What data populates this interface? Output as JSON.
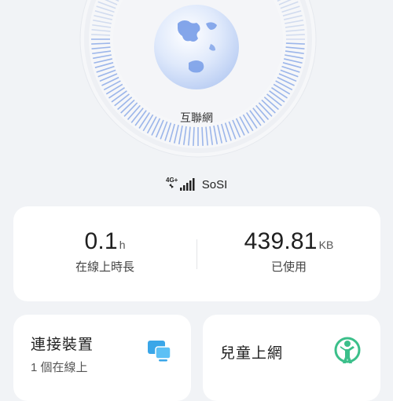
{
  "hero": {
    "internet_label": "互聯網"
  },
  "network": {
    "type_label": "4G+",
    "operator": "SoSI"
  },
  "stats": {
    "online_duration": {
      "value": "0.1",
      "unit": "h",
      "label": "在線上時長"
    },
    "data_used": {
      "value": "439.81",
      "unit": "KB",
      "label": "已使用"
    }
  },
  "devices_card": {
    "title": "連接裝置",
    "subtitle": "1 個在線上",
    "icon": "devices-icon",
    "icon_color": "#3aa6e8"
  },
  "kids_card": {
    "title": "兒童上網",
    "icon": "child-icon",
    "icon_color": "#3bbf8a"
  }
}
